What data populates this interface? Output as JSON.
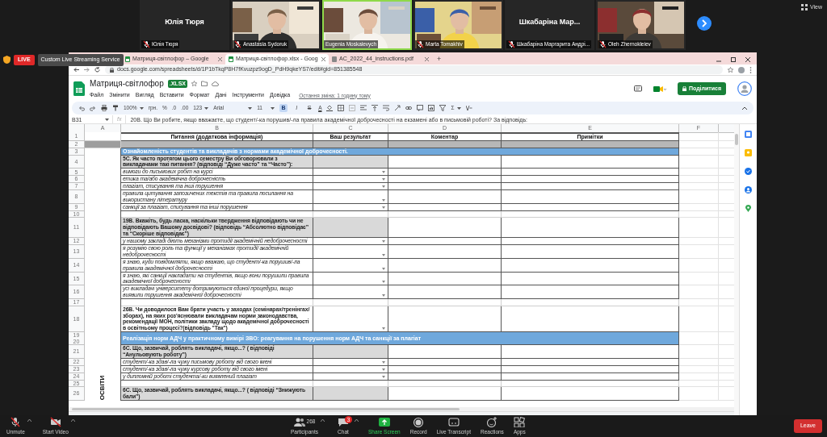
{
  "meeting": {
    "view_label": "View",
    "tiles": [
      {
        "kind": "name",
        "name": "Юлія Тюря",
        "label": "Юлія Тюря",
        "muted": true,
        "speaking": false
      },
      {
        "kind": "video",
        "label": "Anastasia Sydoruk",
        "muted": true,
        "speaking": false
      },
      {
        "kind": "video",
        "label": "Eugenia Moskalevych",
        "muted": false,
        "speaking": true
      },
      {
        "kind": "video",
        "label": "Marta Tomakhiv",
        "muted": true,
        "speaking": false
      },
      {
        "kind": "name",
        "name": "Шкабаріна Мар...",
        "label": "Шкабаріна Маргарита Андрі...",
        "muted": true,
        "speaking": false
      },
      {
        "kind": "video",
        "label": "Oleh Zhernokleiev",
        "muted": true,
        "speaking": false
      }
    ]
  },
  "live_badge": "LIVE",
  "streaming_button": "Custom Live Streaming Service",
  "browser": {
    "tabs": [
      {
        "title": "Матриця-світлофор – Google",
        "selected": false
      },
      {
        "title": "Матриця-світлофор.xlsx - Goog",
        "selected": true
      },
      {
        "title": "AC_2022_44_instructions.pdf",
        "selected": false
      }
    ],
    "new_tab": "+",
    "url": "docs.google.com/spreadsheets/d/1P1bTkqP8H7fKvuzpz9ogD_PdH9qkeYS7/edit#gid=851385548"
  },
  "sheet": {
    "title": "Матриця-світлофор",
    "badge": ".XLSX",
    "menus": [
      "Файл",
      "Змінити",
      "Вигляд",
      "Вставити",
      "Формат",
      "Дані",
      "Інструменти",
      "Довідка"
    ],
    "last_edit": "Остання зміна: 1 годину тому",
    "share_button": "Поділитися",
    "toolbar": {
      "zoom": "100%",
      "currency": "грн.",
      "percent": "%",
      "decimal_less": ".0",
      "decimal_more": ".00",
      "number_format": "123",
      "font": "Arial",
      "font_size": "11",
      "text_color": "A",
      "functions": "Σ"
    },
    "format_buttons": [
      {
        "label": "B",
        "selected": true
      },
      {
        "label": "I",
        "selected": false
      },
      {
        "label": "S",
        "selected": false
      }
    ],
    "cell_ref": "B31",
    "fx": "fx",
    "formula": "20В. Що Ви робите, якщо вважаєте, що студент/-ка порушив/-ла правила академічної доброчесності на екзамені або в письмовій роботі? За відповідь:",
    "columns": [
      "A",
      "B",
      "C",
      "D",
      "E",
      "F"
    ],
    "column_a_label": "ОСВІТИ",
    "rows": [
      {
        "kind": "header",
        "numbers": [
          "1"
        ],
        "cells": [
          "Питання (додаткова інформація)",
          "Ваш результат",
          "Коментар",
          "Примітки"
        ]
      },
      {
        "kind": "gray",
        "numbers": [
          "2"
        ]
      },
      {
        "kind": "section",
        "numbers": [
          "3"
        ],
        "text": "Ознайомленість студентів та викладачів з нормами академічної доброчесності."
      },
      {
        "kind": "question",
        "numbers": [
          "4"
        ],
        "text": "5С. Як часто протягом цього семестру Ви обговорювали з викладачами такі питання? (відповіді “Дуже часто” та “Часто”):"
      },
      {
        "kind": "item",
        "numbers": [
          "5"
        ],
        "text": "вимоги до письмових робіт на курсі"
      },
      {
        "kind": "item",
        "numbers": [
          "6"
        ],
        "text": "етика та/або академічна доброчесність"
      },
      {
        "kind": "item",
        "numbers": [
          "7"
        ],
        "text": "плагіат, списування та інші порушення"
      },
      {
        "kind": "item",
        "numbers": [
          "8"
        ],
        "text": "правила цитування запозичених текстів та правила посилання на використану літературу"
      },
      {
        "kind": "item",
        "numbers": [
          "9"
        ],
        "text": "санкції за плагіат, списування та інші порушення"
      },
      {
        "kind": "blank",
        "numbers": [
          "10"
        ]
      },
      {
        "kind": "question",
        "numbers": [
          "11"
        ],
        "text": "19В. Вкажіть, будь ласка, наскільки твердження відповідають чи не відповідають Вашому досвідові? (відповідь “Абсолютно відповідає” та “Скоріше відповідає”)"
      },
      {
        "kind": "item",
        "numbers": [
          "12"
        ],
        "text": "у нашому закладі діють механізми протидії академічній недоброчесності"
      },
      {
        "kind": "item",
        "numbers": [
          "13"
        ],
        "text": "я розумію свою роль та функції у механізмах протидії академічній недоброчесності"
      },
      {
        "kind": "item",
        "numbers": [
          "14"
        ],
        "text": "я знаю, куди повідомляти, якщо вважаю, що студент/-ка порушив/-ла правила академічної доброчесності"
      },
      {
        "kind": "item",
        "numbers": [
          "15"
        ],
        "text": "я знаю, які санкції накладати на студентів, якщо вони порушили правила академічної доброчесності"
      },
      {
        "kind": "item",
        "numbers": [
          "16"
        ],
        "text": "усі викладачі університету дотримуються єдиної процедури, якщо виявили порушення академічної доброчесності"
      },
      {
        "kind": "blank",
        "numbers": [
          "17"
        ]
      },
      {
        "kind": "prompt",
        "numbers": [
          "18"
        ],
        "text": "26В. Чи доводилося Вам брати участь у заходах (семінарах/тренінгах/зборах), на яких роз'яснювали викладачам норми законодавства, рекомендації МОН, політики закладу щодо академічної доброчесності в освітньому процесі?(відповідь \"Так\")"
      },
      {
        "kind": "section",
        "numbers": [
          "19",
          "20"
        ],
        "text": "Реалізація норм АДЧ у практичному вимірі ЗВО: реагування на порушення норм АДЧ та санкції за плагіат"
      },
      {
        "kind": "question",
        "numbers": [
          "21"
        ],
        "text": "6С. Що, зазвичай, роблять викладачі, якщо...? ( відповіді “Анульовують роботу”)"
      },
      {
        "kind": "item",
        "numbers": [
          "22"
        ],
        "text": "студент/-ка здав/-ла чужу письмову роботу від свого імені"
      },
      {
        "kind": "item",
        "numbers": [
          "23"
        ],
        "text": "студент/-ка здав/-ла чужу курсову роботу від свого імені"
      },
      {
        "kind": "item",
        "numbers": [
          "24"
        ],
        "text": "у дипломній роботі студента/-ки виявлений плагіат"
      },
      {
        "kind": "blank",
        "numbers": [
          "25"
        ]
      },
      {
        "kind": "question",
        "numbers": [
          "26"
        ],
        "text": "6С. Що, зазвичай, роблять викладачі, якщо...? ( відповіді “Знижують бали”)"
      }
    ]
  },
  "zoom_toolbar": [
    {
      "kind": "mic",
      "label": "Unmute"
    },
    {
      "kind": "camera",
      "label": "Start Video"
    },
    {
      "kind": "participants",
      "label": "Participants",
      "count": "268"
    },
    {
      "kind": "chat",
      "label": "Chat",
      "badge": "3"
    },
    {
      "kind": "share",
      "label": "Share Screen"
    },
    {
      "kind": "record",
      "label": "Record"
    },
    {
      "kind": "transcript",
      "label": "Live Transcript"
    },
    {
      "kind": "reactions",
      "label": "Reactions"
    },
    {
      "kind": "apps",
      "label": "Apps"
    }
  ],
  "leave_button": "Leave"
}
